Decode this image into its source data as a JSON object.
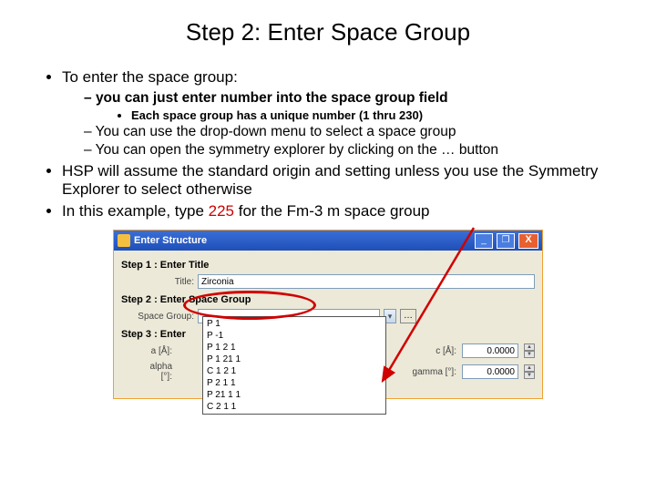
{
  "title": "Step 2: Enter Space Group",
  "b1": "To enter the space group:",
  "b1a": "you can just enter number into the space group field",
  "b1a1": "Each space group has a unique number (1 thru 230)",
  "b1b": "You can use the drop-down menu to select a space group",
  "b1c": "You can open the symmetry explorer by clicking on the … button",
  "b2": "HSP will assume the standard origin and setting unless you use the Symmetry Explorer to select otherwise",
  "b3a": "In this example, type ",
  "b3num": "225",
  "b3b": " for the Fm-3 m space group",
  "win": {
    "title": "Enter Structure",
    "step1": "Step 1 : Enter Title",
    "titleLabel": "Title:",
    "titleValue": "Zirconia",
    "step2": "Step 2 : Enter Space Group",
    "sgLabel": "Space Group:",
    "sgValue": "",
    "ellipsis": "…",
    "step3": "Step 3 : Enter",
    "aLabel": "a [Å]:",
    "cLabel": "c [Å]:",
    "alphaLabel": "alpha [°]:",
    "gammaLabel": "gamma [°]:",
    "numVal": "0.0000",
    "dropdown": [
      "P 1",
      "P -1",
      "P 1 2 1",
      "P 1 21 1",
      "C 1 2 1",
      "P 2 1 1",
      "P 21 1 1",
      "C 2 1 1"
    ]
  }
}
